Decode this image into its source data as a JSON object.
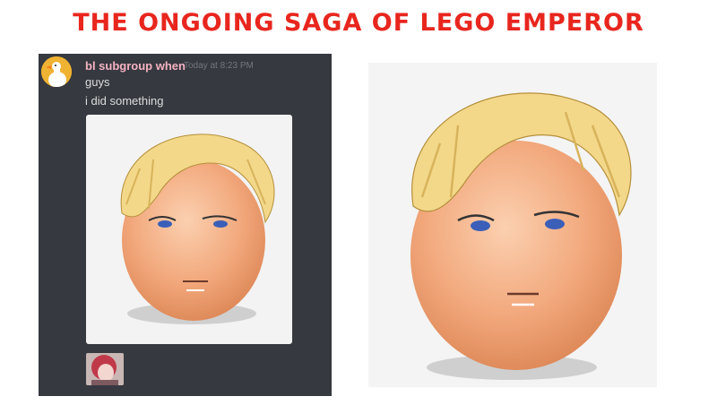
{
  "meme": {
    "title": "THE ONGOING SAGA OF LEGO EMPEROR"
  },
  "message": {
    "username": "bl subgroup when",
    "timestamp": "Today at 8:23 PM",
    "lines": [
      "guys",
      "i did something"
    ]
  },
  "colors": {
    "title": "#e8261e",
    "chat_background": "#36393f",
    "username": "#f5b3c2",
    "egg_skin": "#f2a87c",
    "hair": "#f3d88a"
  },
  "icons": {
    "avatar": "goose-avatar-icon",
    "thumbnail": "red-haired-anime-thumbnail"
  }
}
